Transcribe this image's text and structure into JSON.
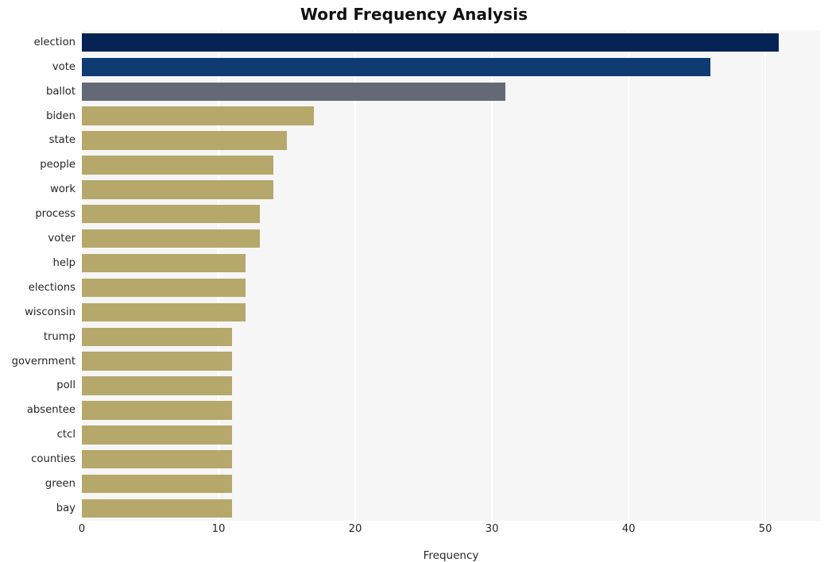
{
  "chart_data": {
    "type": "bar",
    "orientation": "horizontal",
    "title": "Word Frequency Analysis",
    "xlabel": "Frequency",
    "ylabel": "",
    "xlim": [
      0,
      54
    ],
    "xticks": [
      0,
      10,
      20,
      30,
      40,
      50
    ],
    "xtick_labels": [
      "0",
      "10",
      "20",
      "30",
      "40",
      "50"
    ],
    "grid": "vertical-white",
    "legend": "none",
    "categories": [
      "election",
      "vote",
      "ballot",
      "biden",
      "state",
      "people",
      "work",
      "process",
      "voter",
      "help",
      "elections",
      "wisconsin",
      "trump",
      "government",
      "poll",
      "absentee",
      "ctcl",
      "counties",
      "green",
      "bay"
    ],
    "values": [
      51,
      46,
      31,
      17,
      15,
      14,
      14,
      13,
      13,
      12,
      12,
      12,
      11,
      11,
      11,
      11,
      11,
      11,
      11,
      11
    ],
    "bar_colors": [
      "#042253",
      "#0d3b72",
      "#646a75",
      "#b5a86a",
      "#b5a86a",
      "#b5a86a",
      "#b5a86a",
      "#b5a86a",
      "#b5a86a",
      "#b5a86a",
      "#b5a86a",
      "#b5a86a",
      "#b5a86a",
      "#b5a86a",
      "#b5a86a",
      "#b5a86a",
      "#b5a86a",
      "#b5a86a",
      "#b5a86a",
      "#b5a86a"
    ]
  },
  "style": {
    "figure_background": "#ffffff",
    "plot_background": "#f6f6f7",
    "gridline_color": "#ffffff",
    "text_color": "#262626",
    "title_color": "#111111"
  }
}
